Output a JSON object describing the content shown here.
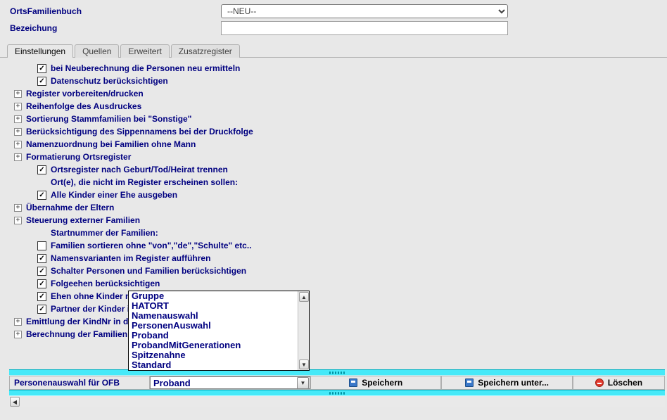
{
  "form": {
    "label_ofb": "OrtsFamilienbuch",
    "label_bez": "Bezeichung",
    "select_value": "--NEU--",
    "input_value": ""
  },
  "tabs": {
    "t0": "Einstellungen",
    "t1": "Quellen",
    "t2": "Erweitert",
    "t3": "Zusatzregister"
  },
  "tree": {
    "i0": "bei Neuberechnung die Personen neu ermitteln",
    "i1": "Datenschutz berücksichtigen",
    "i2": "Register vorbereiten/drucken",
    "i3": "Reihenfolge des Ausdruckes",
    "i4": "Sortierung Stammfamilien bei \"Sonstige\"",
    "i5": "Berücksichtigung des Sippennamens bei der Druckfolge",
    "i6": "Namenzuordnung bei Familien ohne Mann",
    "i7": "Formatierung Ortsregister",
    "i8": "Ortsregister nach Geburt/Tod/Heirat trennen",
    "i9": "Ort(e), die nicht im Register erscheinen sollen:",
    "i10": "Alle Kinder einer Ehe ausgeben",
    "i11": "Übernahme der Eltern",
    "i12": "Steuerung externer Familien",
    "i13": "Startnummer der Familien:",
    "i14": "Familien sortieren ohne \"von\",\"de\",\"Schulte\" etc..",
    "i15": "Namensvarianten im Register aufführen",
    "i16": "Schalter Personen und Familien berücksichtigen",
    "i17": "Folgeehen berücksichtigen",
    "i18": "Ehen ohne Kinder mit A",
    "i19": "Partner der Kinder imm",
    "i20": "Emittlung der KindNr in de",
    "i21": "Berechnung der Familien"
  },
  "listbox": {
    "o0": "Gruppe",
    "o1": "HATORT",
    "o2": "Namenauswahl",
    "o3": "PersonenAuswahl",
    "o4": "Proband",
    "o5": "ProbandMitGenerationen",
    "o6": "Spitzenahne",
    "o7": "Standard"
  },
  "bottom": {
    "label": "Personenauswahl für OFB",
    "value": "Proband",
    "btn_save": "Speichern",
    "btn_saveas": "Speichern unter...",
    "btn_delete": "Löschen"
  }
}
